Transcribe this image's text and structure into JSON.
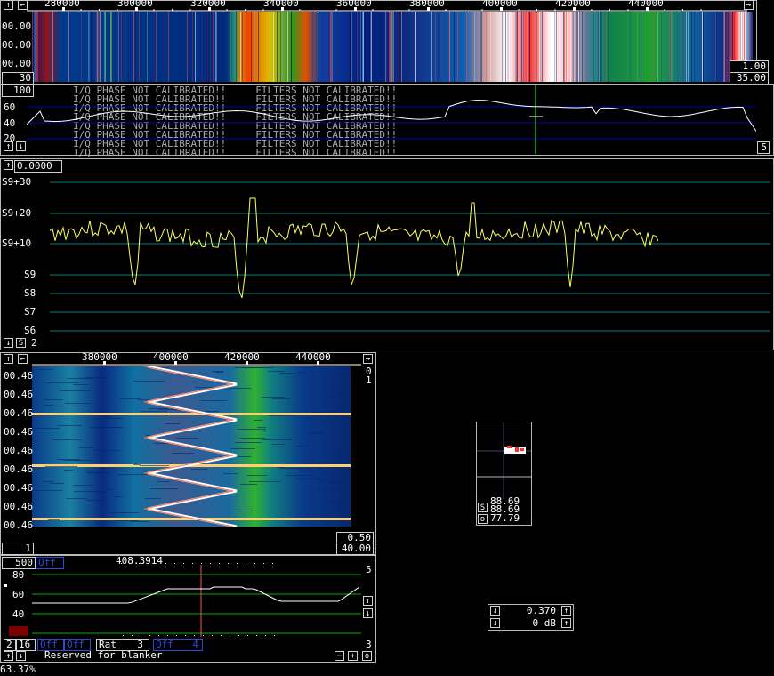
{
  "colors": {
    "waterfall_bg": "#001a6e",
    "trace": "#ffff60",
    "grid": "#00a000",
    "grid_blue": "#0000c0",
    "cursor": "#40ff40"
  },
  "main_waterfall": {
    "freq_ticks": [
      "280000",
      "300000",
      "320000",
      "340000",
      "360000",
      "380000",
      "400000",
      "420000",
      "440000"
    ],
    "time_labels": [
      "00.00.44",
      "00.00.39",
      "00.00.35"
    ],
    "gain_value": "1.00",
    "offset_value": "35.00",
    "avg_value": "30"
  },
  "main_spectrum": {
    "top_value": "100",
    "y_labels": [
      "60",
      "40",
      "20"
    ],
    "bottom_right_value": "5",
    "warning_lines": [
      "I/Q PHASE NOT CALIBRATED!!     FILTERS NOT CALIBRATED!!",
      "I/Q PHASE NOT CALIBRATED!!     FILTERS NOT CALIBRATED!!",
      "I/Q PHASE NOT CALIBRATED!!     FILTERS NOT CALIBRATED!!",
      "I/Q PHASE NOT CALIBRATED!!     FILTERS NOT CALIBRATED!!",
      "I/Q PHASE NOT CALIBRATED!!     FILTERS NOT CALIBRATED!!",
      "I/Q PHASE NOT CALIBRATED!!     FILTERS NOT CALIBRATED!!",
      "I/Q PHASE NOT CALIBRATED!!     FILTERS NOT CALIBRATED!!",
      "I/Q PHASE NOT CALIBRATED!!     FILTERS NOT CALIBRATED!!"
    ]
  },
  "s_meter": {
    "top_value": "0.0000",
    "levels": [
      "S9+30",
      "S9+20",
      "S9+10",
      "S9",
      "S8",
      "S7",
      "S6"
    ],
    "bottom_label": "S",
    "bottom_value": "2"
  },
  "high_res": {
    "freq_ticks": [
      "380000",
      "400000",
      "420000",
      "440000"
    ],
    "time_labels": [
      "00.46",
      "00.46",
      "00.46",
      "00.46",
      "00.46",
      "00.46",
      "00.46",
      "00.46",
      "00.46"
    ],
    "right_top": "0",
    "right_top2": "1",
    "gain_value": "0.50",
    "offset_value": "40.00",
    "avg_value": "1"
  },
  "baseband": {
    "bw_value": "500",
    "off_label": "Off",
    "freq_readout": "408.3914",
    "y_labels": [
      "80",
      "60",
      "40"
    ],
    "right_top": "5",
    "right_bottom": "3",
    "ctrl_2": "2",
    "ctrl_16": "16",
    "off_a": "Off",
    "off_b": "Off",
    "rat_label": "Rat",
    "rat_value": "3",
    "off_c": "Off",
    "off_c_value": "4",
    "blanker_text": "Reserved for blanker",
    "minus_label": "−",
    "plus_label": "+",
    "o_label": "o"
  },
  "afc": {
    "s_value": "88.69",
    "mid_value": "88.69",
    "o_value": "77.79",
    "s_label": "S",
    "o_label": "o"
  },
  "coherent": {
    "value1": "0.370",
    "value2": "0 dB"
  },
  "status": {
    "cpu_load": "63.37%"
  },
  "chart_data": {
    "type": "line",
    "title": "",
    "series": [
      {
        "name": "",
        "values": []
      }
    ]
  }
}
